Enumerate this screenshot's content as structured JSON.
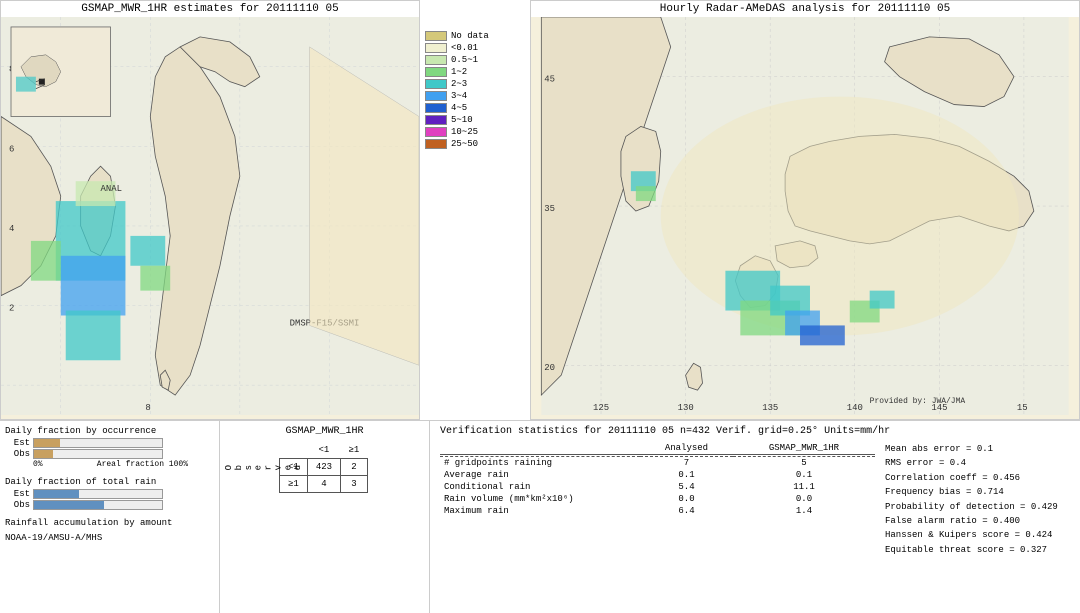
{
  "left_map": {
    "title": "GSMAP_MWR_1HR estimates for 20111110 05",
    "labels": {
      "satellite": "DMSP-F15/SSMI",
      "anal": "ANAL",
      "noaa": "NOAA-19/AMSU-A/MHS"
    },
    "axis_labels": {
      "y": [
        "8",
        "6",
        "4",
        "2"
      ],
      "x": [
        "8"
      ]
    }
  },
  "right_map": {
    "title": "Hourly Radar-AMeDAS analysis for 20111110 05",
    "axis_labels": {
      "y": [
        "45",
        "35",
        "20"
      ],
      "x": [
        "125",
        "130",
        "135",
        "140",
        "145",
        "15"
      ]
    },
    "provided_by": "Provided by: JWA/JMA"
  },
  "legend": {
    "items": [
      {
        "label": "No data",
        "color": "#d4c87a"
      },
      {
        "label": "<0.01",
        "color": "#f0f0d0"
      },
      {
        "label": "0.5~1",
        "color": "#c8e8b0"
      },
      {
        "label": "1~2",
        "color": "#80d880"
      },
      {
        "label": "2~3",
        "color": "#40c8c8"
      },
      {
        "label": "3~4",
        "color": "#40a0f0"
      },
      {
        "label": "4~5",
        "color": "#2060d0"
      },
      {
        "label": "5~10",
        "color": "#6020c0"
      },
      {
        "label": "10~25",
        "color": "#e040c0"
      },
      {
        "label": "25~50",
        "color": "#c06020"
      }
    ]
  },
  "bar_charts": {
    "occurrence_title": "Daily fraction by occurrence",
    "est_label": "Est",
    "obs_label": "Obs",
    "axis_0": "0%",
    "axis_100": "Areal fraction   100%",
    "total_rain_title": "Daily fraction of total rain",
    "rainfall_label": "Rainfall accumulation by amount"
  },
  "contingency": {
    "title": "GSMAP_MWR_1HR",
    "col_lt1": "<1",
    "col_ge1": "≥1",
    "row_lt1": "<1",
    "row_ge1": "≥1",
    "observed_label": "O\nb\ns\ne\nr\nv\ne\nd",
    "values": {
      "lt1_lt1": "423",
      "lt1_ge1": "2",
      "ge1_lt1": "4",
      "ge1_ge1": "3"
    }
  },
  "verification": {
    "title": "Verification statistics for 20111110 05  n=432  Verif. grid=0.25°  Units=mm/hr",
    "columns": [
      "Analysed",
      "GSMAP_MWR_1HR"
    ],
    "rows": [
      {
        "label": "# gridpoints raining",
        "analysed": "7",
        "gsmap": "5"
      },
      {
        "label": "Average rain",
        "analysed": "0.1",
        "gsmap": "0.1"
      },
      {
        "label": "Conditional rain",
        "analysed": "5.4",
        "gsmap": "11.1"
      },
      {
        "label": "Rain volume (mm*km²x10⁶)",
        "analysed": "0.0",
        "gsmap": "0.0"
      },
      {
        "label": "Maximum rain",
        "analysed": "6.4",
        "gsmap": "1.4"
      }
    ],
    "stats": [
      {
        "label": "Mean abs error = 0.1"
      },
      {
        "label": "RMS error = 0.4"
      },
      {
        "label": "Correlation coeff = 0.456"
      },
      {
        "label": "Frequency bias = 0.714"
      },
      {
        "label": "Probability of detection = 0.429"
      },
      {
        "label": "False alarm ratio = 0.400"
      },
      {
        "label": "Hanssen & Kuipers score = 0.424"
      },
      {
        "label": "Equitable threat score = 0.327"
      }
    ]
  }
}
